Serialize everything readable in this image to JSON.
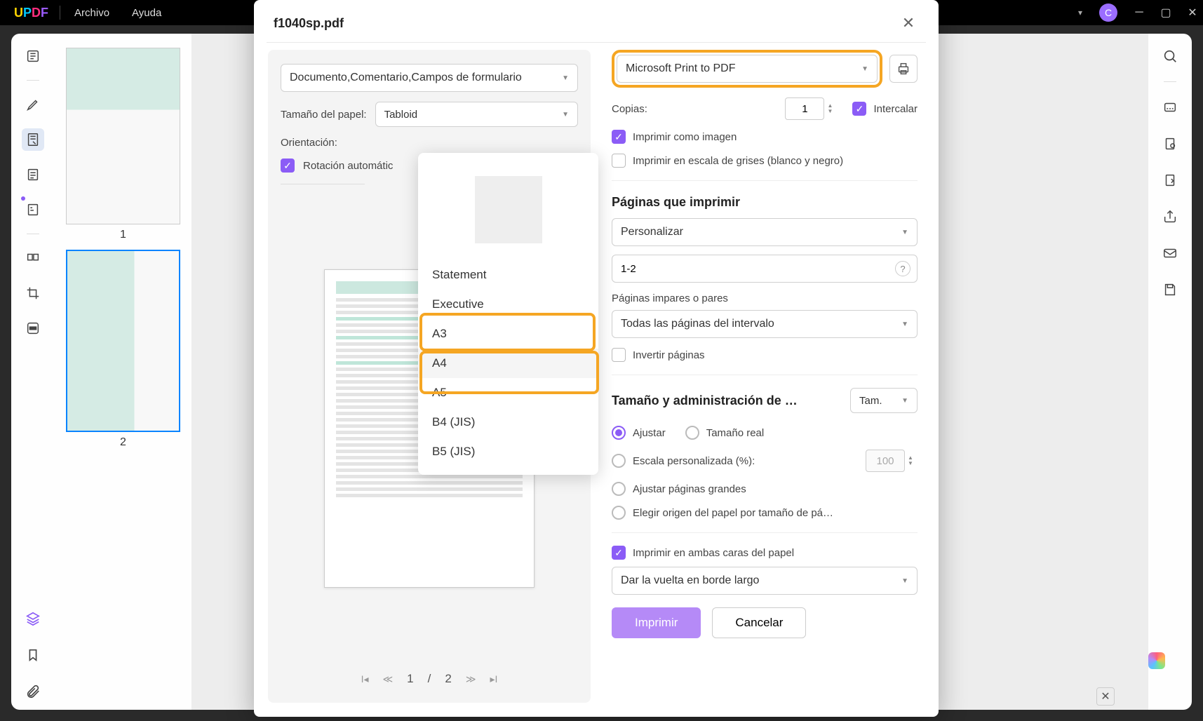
{
  "titlebar": {
    "logo": {
      "u": "U",
      "p": "P",
      "d": "D",
      "f": "F"
    },
    "menu_file": "Archivo",
    "menu_help": "Ayuda",
    "avatar": "C"
  },
  "thumbs": {
    "p1": "1",
    "p2": "2"
  },
  "dialog": {
    "title": "f1040sp.pdf",
    "content_select": "Documento,Comentario,Campos de formulario",
    "paper_label": "Tamaño del papel:",
    "paper_value": "Tabloid",
    "orientation_label": "Orientación:",
    "auto_rotate": "Rotación automátic",
    "page_cur": "1",
    "page_sep": "/",
    "page_total": "2",
    "printer": "Microsoft Print to PDF",
    "copies_label": "Copias:",
    "copies_value": "1",
    "collate": "Intercalar",
    "print_as_image": "Imprimir como imagen",
    "grayscale": "Imprimir en escala de grises (blanco y negro)",
    "pages_title": "Páginas que imprimir",
    "range_mode": "Personalizar",
    "range_value": "1-2",
    "odd_even_label": "Páginas impares o pares",
    "odd_even_value": "Todas las páginas del intervalo",
    "reverse": "Invertir páginas",
    "size_title": "Tamaño y administración de …",
    "size_select": "Tam.",
    "fit": "Ajustar",
    "actual": "Tamaño real",
    "custom_scale": "Escala personalizada (%):",
    "custom_scale_val": "100",
    "fit_large": "Ajustar páginas grandes",
    "choose_source": "Elegir origen del papel por tamaño de pá…",
    "duplex": "Imprimir en ambas caras del papel",
    "flip": "Dar la vuelta en borde largo",
    "print_btn": "Imprimir",
    "cancel_btn": "Cancelar"
  },
  "paper_sizes": [
    "Statement",
    "Executive",
    "A3",
    "A4",
    "A5",
    "B4 (JIS)",
    "B5 (JIS)"
  ]
}
